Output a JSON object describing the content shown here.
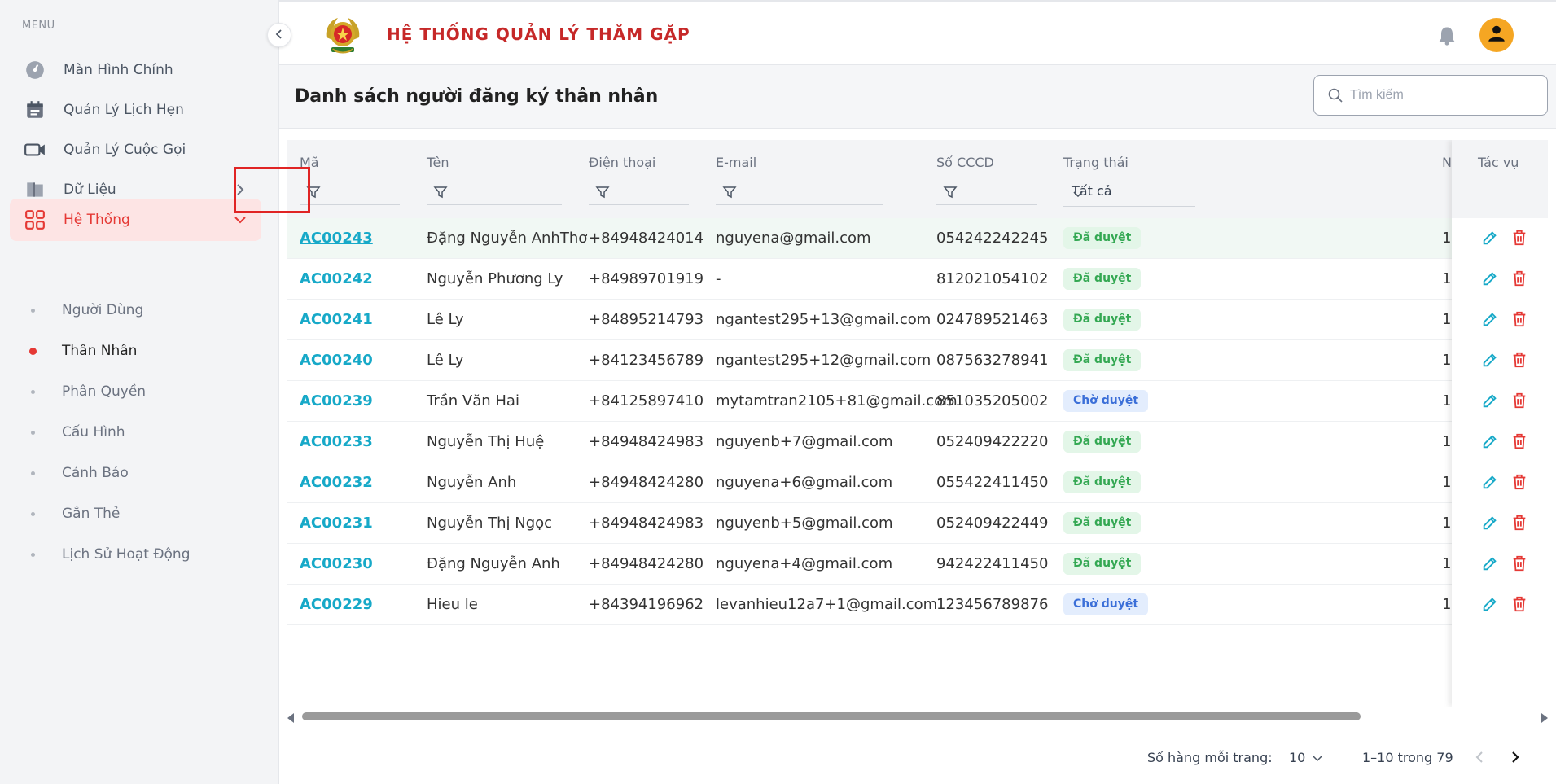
{
  "sidebar": {
    "menu_label": "MENU",
    "items": [
      {
        "label": "Màn Hình Chính",
        "icon": "dashboard-gauge-icon"
      },
      {
        "label": "Quản Lý Lịch Hẹn",
        "icon": "calendar-icon"
      },
      {
        "label": "Quản Lý Cuộc Gọi",
        "icon": "video-camera-icon"
      },
      {
        "label": "Dữ Liệu",
        "icon": "folder-icon"
      },
      {
        "label": "Hệ Thống",
        "icon": "grid-apps-icon"
      }
    ],
    "sub_items": [
      {
        "label": "Người Dùng"
      },
      {
        "label": "Thân Nhân"
      },
      {
        "label": "Phân Quyền"
      },
      {
        "label": "Cấu Hình"
      },
      {
        "label": "Cảnh Báo"
      },
      {
        "label": "Gắn Thẻ"
      },
      {
        "label": "Lịch Sử Hoạt Động"
      }
    ]
  },
  "header": {
    "app_title": "HỆ THỐNG QUẢN LÝ THĂM GẶP"
  },
  "page": {
    "title": "Danh sách người đăng ký thân nhân",
    "search_placeholder": "Tìm kiếm"
  },
  "table": {
    "columns": {
      "code": "Mã",
      "name": "Tên",
      "phone": "Điện thoại",
      "email": "E-mail",
      "cccd": "Số CCCD",
      "status": "Trạng thái",
      "actions": "Tác vụ"
    },
    "status_filter": "Tất cả",
    "rows": [
      {
        "code": "AC00243",
        "name": "Đặng Nguyễn AnhThơ",
        "phone": "+84948424014",
        "email": "nguyena@gmail.com",
        "cccd": "054242242245",
        "status": "Đã duyệt",
        "status_kind": "ok",
        "n": "1"
      },
      {
        "code": "AC00242",
        "name": "Nguyễn Phương Ly",
        "phone": "+84989701919",
        "email": "-",
        "cccd": "812021054102",
        "status": "Đã duyệt",
        "status_kind": "ok",
        "n": "1"
      },
      {
        "code": "AC00241",
        "name": "Lê Ly",
        "phone": "+84895214793",
        "email": "ngantest295+13@gmail.com",
        "cccd": "024789521463",
        "status": "Đã duyệt",
        "status_kind": "ok",
        "n": "1"
      },
      {
        "code": "AC00240",
        "name": "Lê Ly",
        "phone": "+84123456789",
        "email": "ngantest295+12@gmail.com",
        "cccd": "087563278941",
        "status": "Đã duyệt",
        "status_kind": "ok",
        "n": "1"
      },
      {
        "code": "AC00239",
        "name": "Trần Văn Hai",
        "phone": "+84125897410",
        "email": "mytamtran2105+81@gmail.com",
        "cccd": "851035205002",
        "status": "Chờ duyệt",
        "status_kind": "wait",
        "n": "1"
      },
      {
        "code": "AC00233",
        "name": "Nguyễn Thị Huệ",
        "phone": "+84948424983",
        "email": "nguyenb+7@gmail.com",
        "cccd": "052409422220",
        "status": "Đã duyệt",
        "status_kind": "ok",
        "n": "1"
      },
      {
        "code": "AC00232",
        "name": "Nguyễn Anh",
        "phone": "+84948424280",
        "email": "nguyena+6@gmail.com",
        "cccd": "055422411450",
        "status": "Đã duyệt",
        "status_kind": "ok",
        "n": "1"
      },
      {
        "code": "AC00231",
        "name": "Nguyễn Thị Ngọc",
        "phone": "+84948424983",
        "email": "nguyenb+5@gmail.com",
        "cccd": "052409422449",
        "status": "Đã duyệt",
        "status_kind": "ok",
        "n": "1"
      },
      {
        "code": "AC00230",
        "name": "Đặng Nguyễn Anh",
        "phone": "+84948424280",
        "email": "nguyena+4@gmail.com",
        "cccd": "942422411450",
        "status": "Đã duyệt",
        "status_kind": "ok",
        "n": "1"
      },
      {
        "code": "AC00229",
        "name": "Hieu le",
        "phone": "+84394196962",
        "email": "levanhieu12a7+1@gmail.com",
        "cccd": "123456789876",
        "status": "Chờ duyệt",
        "status_kind": "wait",
        "n": "1"
      }
    ]
  },
  "pagination": {
    "rows_per_page_label": "Số hàng mỗi trang:",
    "rows_per_page": "10",
    "range": "1–10 trong 79"
  },
  "colors": {
    "accent_red": "#e53935",
    "link_cyan": "#17a9c8",
    "approved_green": "#34a853",
    "pending_blue": "#3b6fd8",
    "avatar_orange": "#f5a623"
  }
}
